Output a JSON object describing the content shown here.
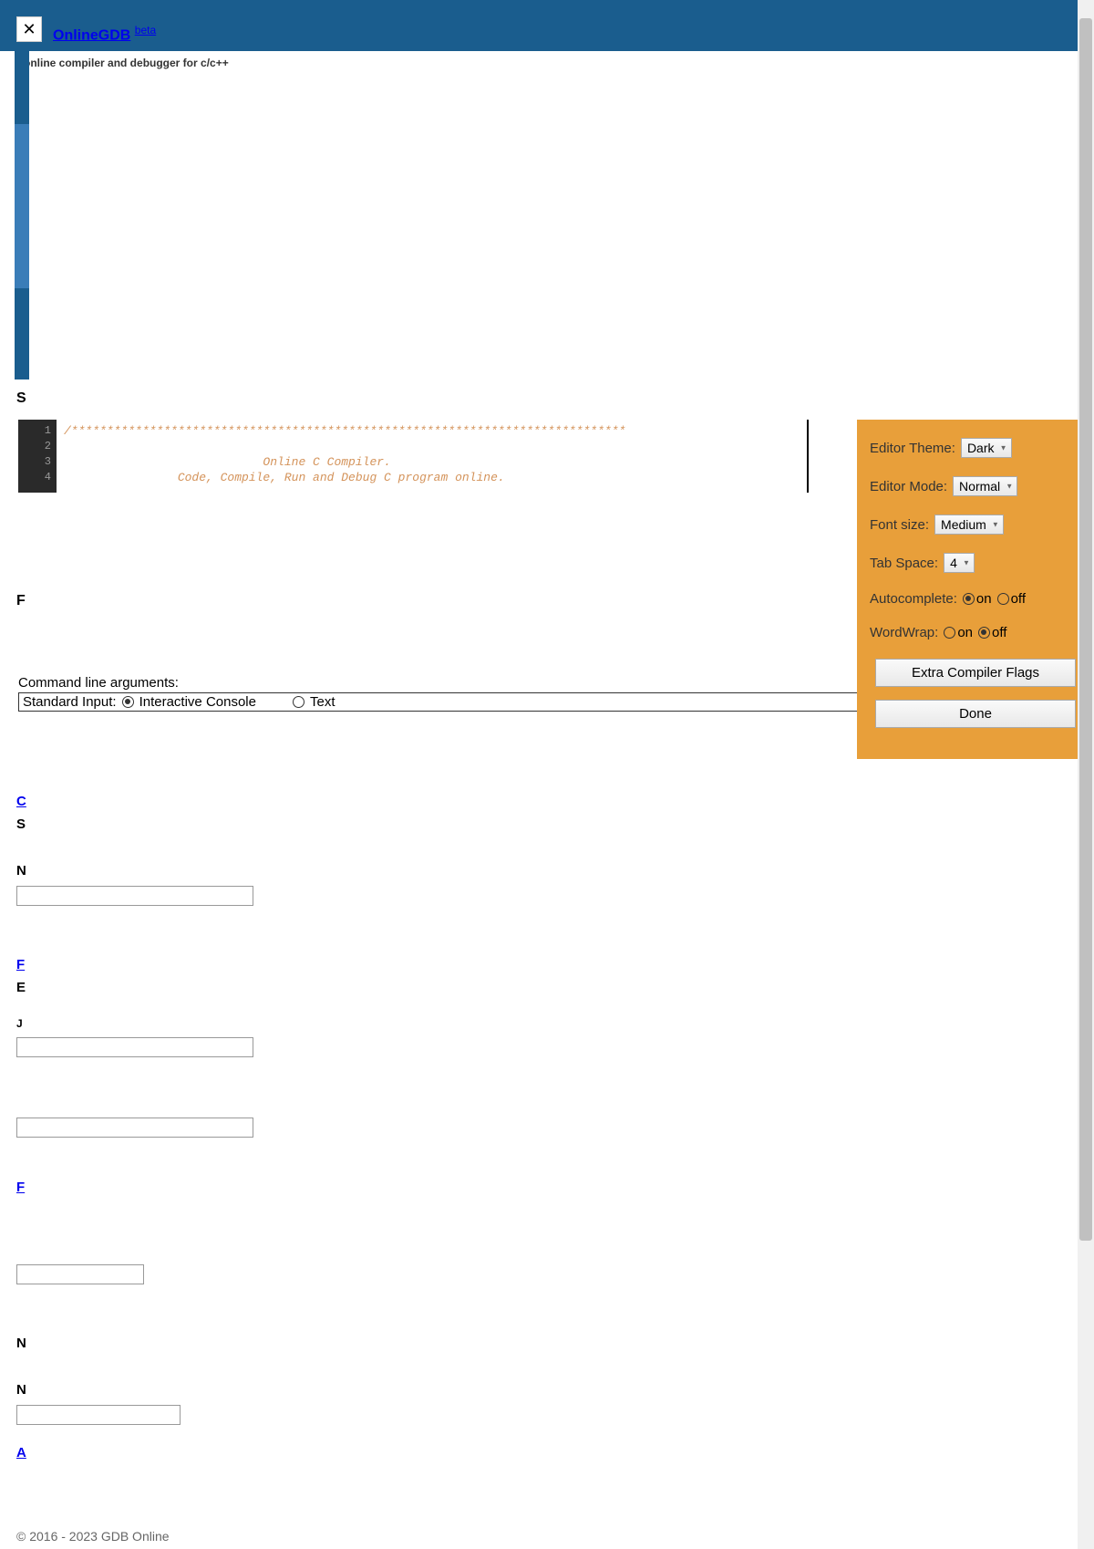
{
  "header": {
    "close_label": "✕",
    "logo_text": "OnlineGDB",
    "beta_text": "beta",
    "tagline": "online compiler and debugger for c/c++"
  },
  "editor": {
    "line_numbers": [
      "1",
      "2",
      "3",
      "4"
    ],
    "code_lines": [
      "/******************************************************************************",
      "",
      "                            Online C Compiler.",
      "                Code, Compile, Run and Debug C program online."
    ]
  },
  "input": {
    "cmdline_label": "Command line arguments:",
    "stdin_label": "Standard Input:",
    "interactive_label": "Interactive Console",
    "text_label": "Text"
  },
  "settings": {
    "theme_label": "Editor Theme:",
    "theme_value": "Dark",
    "mode_label": "Editor Mode:",
    "mode_value": "Normal",
    "font_label": "Font size:",
    "font_value": "Medium",
    "tab_label": "Tab Space:",
    "tab_value": "4",
    "autocomplete_label": "Autocomplete:",
    "wordwrap_label": "WordWrap:",
    "on_label": "on",
    "off_label": "off",
    "extra_flags_label": "Extra Compiler Flags",
    "done_label": "Done"
  },
  "scattered": {
    "letter_s": "S",
    "letter_f": "F",
    "letter_c": "C",
    "letter_s2": "S",
    "letter_n": "N",
    "letter_f2": "F",
    "letter_e": "E",
    "letter_j": "J",
    "letter_f3": "F",
    "letter_n2": "N",
    "letter_n3": "N",
    "letter_a": "A"
  },
  "footer": {
    "copyright": "© 2016 - 2023 GDB Online"
  }
}
